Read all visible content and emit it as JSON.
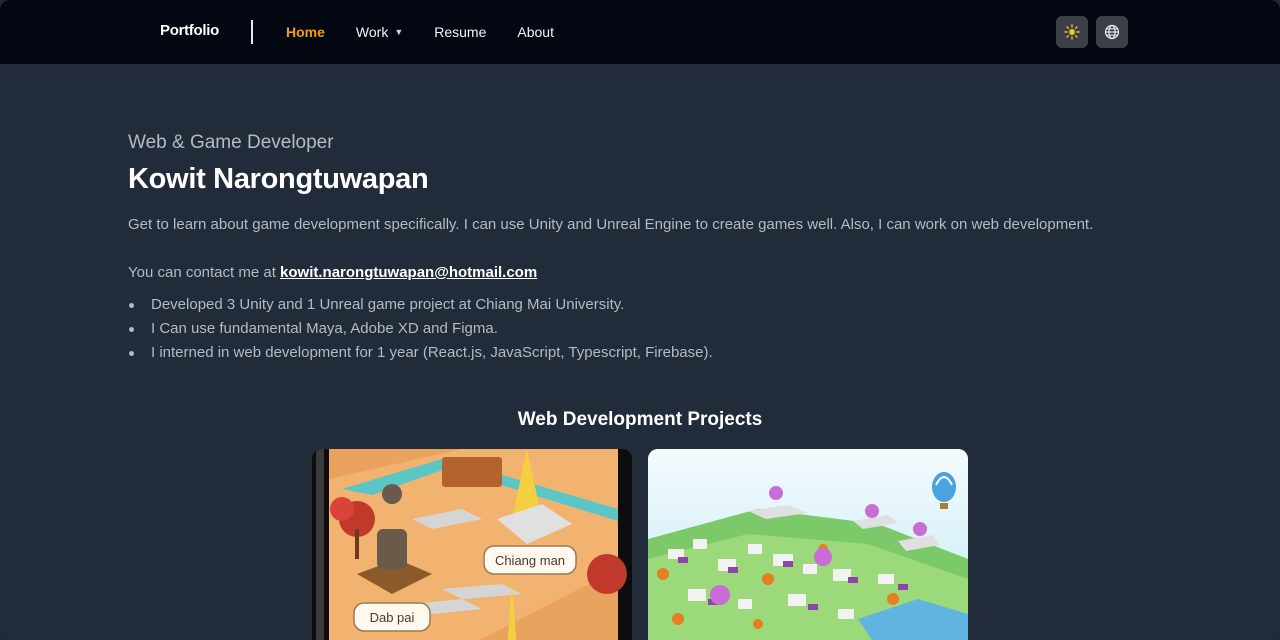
{
  "nav": {
    "brand": "Portfolio",
    "links": [
      {
        "label": "Home",
        "active": true
      },
      {
        "label": "Work",
        "has_dropdown": true
      },
      {
        "label": "Resume"
      },
      {
        "label": "About"
      }
    ],
    "theme_icon": "sun-icon",
    "language_icon": "globe-icon"
  },
  "hero": {
    "subtitle": "Web & Game Developer",
    "name": "Kowit Narongtuwapan",
    "description": "Get to learn about game development specifically. I can use Unity and Unreal Engine to create games well. Also, I can work on web development.",
    "contact_prefix": "You can contact me at ",
    "email": "kowit.narongtuwapan@hotmail.com",
    "bullets": [
      "Developed 3 Unity and 1 Unreal game project at Chiang Mai University.",
      "I Can use fundamental Maya, Adobe XD and Figma.",
      "I interned in web development for 1 year (React.js, JavaScript, Typescript, Firebase)."
    ]
  },
  "projects": {
    "title": "Web Development Projects",
    "cards": [
      {
        "labels": [
          "Chiang man",
          "Dab pai"
        ]
      },
      {}
    ]
  },
  "colors": {
    "nav_bg": "#030712",
    "page_bg": "#222b3a",
    "accent": "#f59e0b"
  }
}
